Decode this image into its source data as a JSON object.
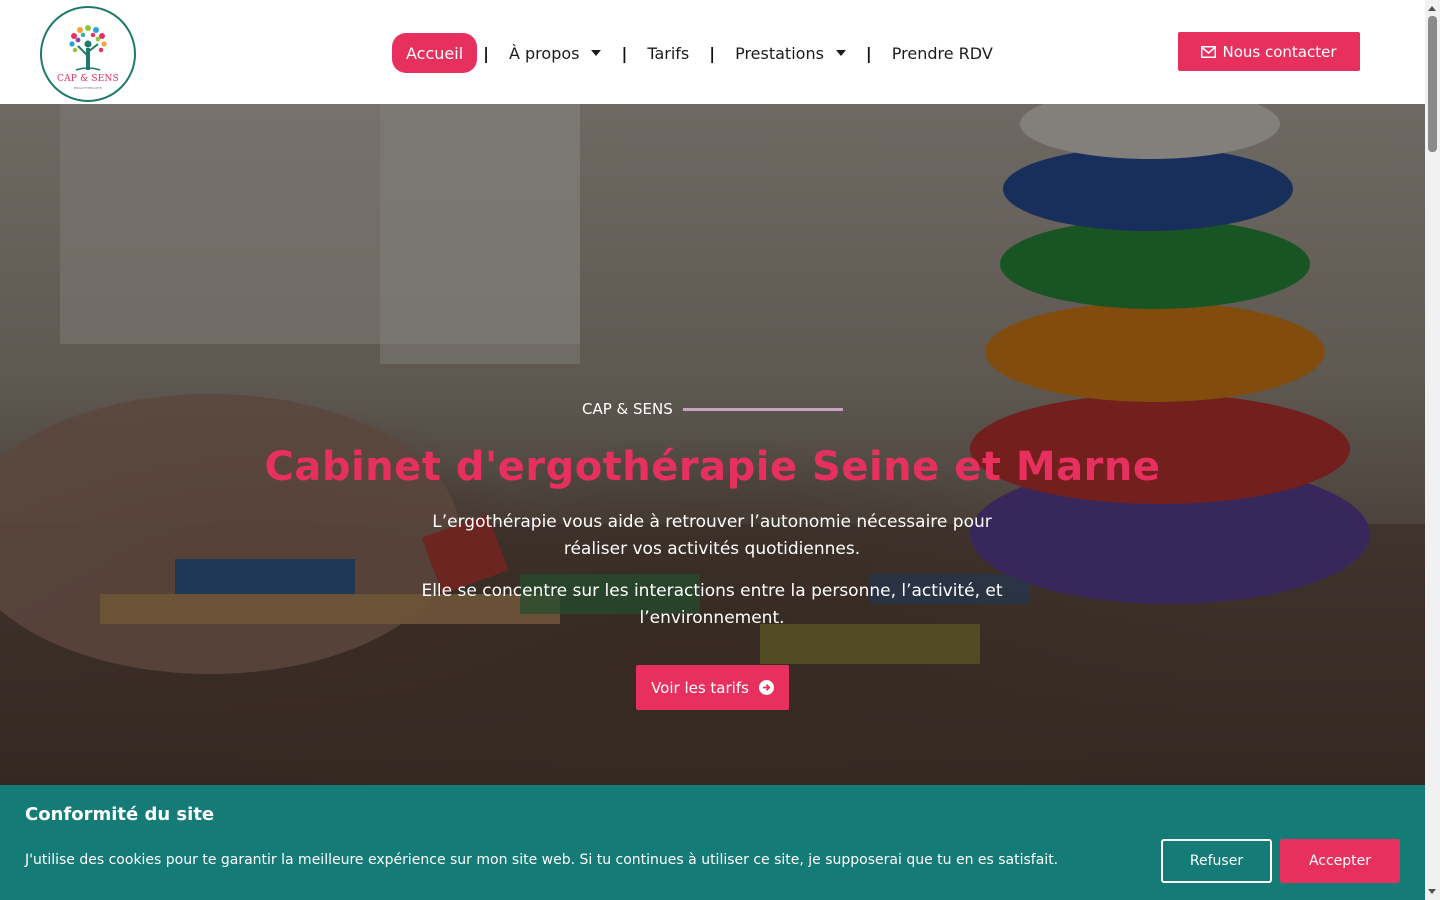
{
  "header": {
    "logo": {
      "title": "CAP & SENS",
      "subtitle": "ERGOTHÉRAPIE"
    },
    "nav": [
      {
        "label": "Accueil",
        "active": true,
        "dropdown": false
      },
      {
        "label": "À propos",
        "active": false,
        "dropdown": true
      },
      {
        "label": "Tarifs",
        "active": false,
        "dropdown": false
      },
      {
        "label": "Prestations",
        "active": false,
        "dropdown": true
      },
      {
        "label": "Prendre RDV",
        "active": false,
        "dropdown": false
      }
    ],
    "separator": "|",
    "contact_label": "Nous contacter"
  },
  "hero": {
    "eyebrow": "CAP & SENS",
    "title": "Cabinet d'ergothérapie Seine et Marne",
    "paragraph1": "L’ergothérapie vous aide à retrouver l’autonomie nécessaire pour réaliser vos activités quotidiennes.",
    "paragraph2": "Elle se concentre sur les interactions entre la personne, l’activité, et l’environnement.",
    "cta_label": "Voir les tarifs"
  },
  "cookie": {
    "title": "Conformité du site",
    "text": "J'utilise des cookies pour te garantir la meilleure expérience sur mon site web. Si tu continues à utiliser ce site, je supposerai que tu en es satisfait.",
    "refuse_label": "Refuser",
    "accept_label": "Accepter"
  },
  "colors": {
    "brand_pink": "#e8305f",
    "cookie_teal": "#157b76",
    "logo_green": "#1f7a6b"
  },
  "icons": {
    "contact": "envelope-icon",
    "cta": "arrow-circle-right-icon",
    "dropdown": "caret-down-icon"
  }
}
